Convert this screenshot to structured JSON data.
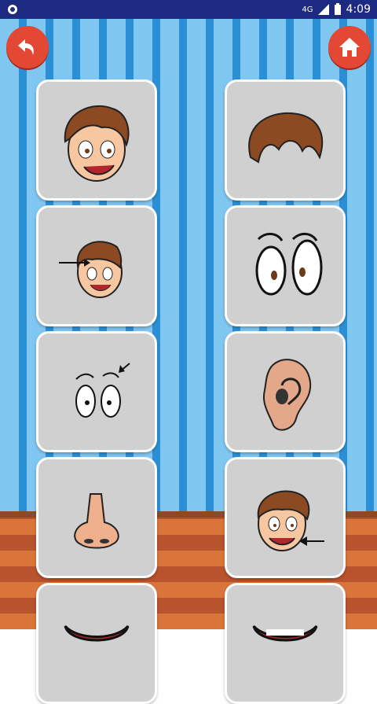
{
  "status": {
    "time": "4:09",
    "network": "4G"
  },
  "colors": {
    "accent": "#e24833",
    "status": "#1d2a82"
  },
  "icons": {
    "back": "back-arrow-icon",
    "home": "home-icon",
    "cards": [
      "boy-face-icon",
      "hair-icon",
      "eyebrow-pointer-icon",
      "eyes-icon",
      "eyes-pointer-icon",
      "ear-icon",
      "nose-icon",
      "cheek-pointer-icon",
      "mouth-icon",
      "mouth-icon"
    ]
  }
}
